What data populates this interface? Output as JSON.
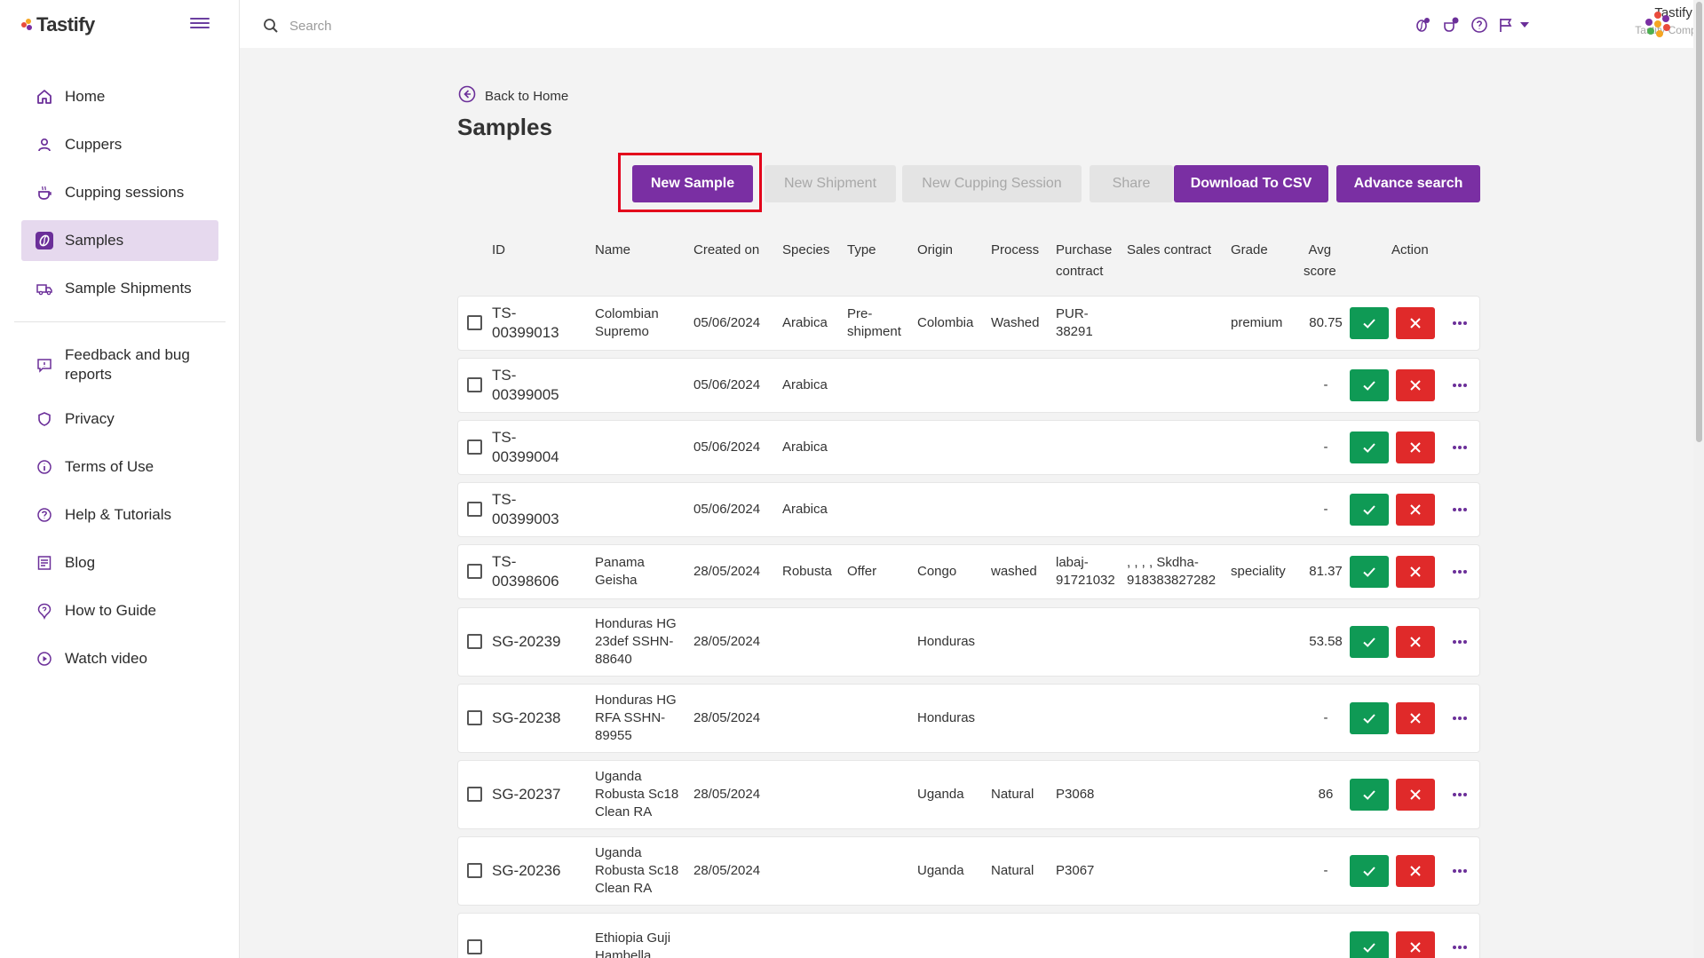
{
  "app": {
    "logo_text": "Tastify"
  },
  "search": {
    "placeholder": "Search"
  },
  "user": {
    "name": "Tastify Inc",
    "company": "Tastify Company"
  },
  "sidebar": {
    "items": [
      {
        "label": "Home",
        "icon": "home-icon"
      },
      {
        "label": "Cuppers",
        "icon": "user-icon"
      },
      {
        "label": "Cupping sessions",
        "icon": "cup-icon"
      },
      {
        "label": "Samples",
        "icon": "coffee-bean-icon",
        "active": true
      },
      {
        "label": "Sample Shipments",
        "icon": "truck-icon"
      }
    ],
    "secondary": [
      {
        "label": "Feedback and bug reports",
        "icon": "feedback-icon"
      },
      {
        "label": "Privacy",
        "icon": "shield-icon"
      },
      {
        "label": "Terms of Use",
        "icon": "info-icon"
      },
      {
        "label": "Help & Tutorials",
        "icon": "help-icon"
      },
      {
        "label": "Blog",
        "icon": "blog-icon"
      },
      {
        "label": "How to Guide",
        "icon": "guide-icon"
      },
      {
        "label": "Watch video",
        "icon": "play-icon"
      }
    ]
  },
  "page": {
    "back_label": "Back to Home",
    "title": "Samples"
  },
  "toolbar": {
    "new_sample": "New Sample",
    "new_shipment": "New Shipment",
    "new_cupping_session": "New Cupping Session",
    "share": "Share",
    "download_csv": "Download To CSV",
    "advance_search": "Advance search"
  },
  "table": {
    "headers": {
      "id": "ID",
      "name": "Name",
      "created_on": "Created on",
      "species": "Species",
      "type": "Type",
      "origin": "Origin",
      "process": "Process",
      "purchase_contract_1": "Purchase",
      "purchase_contract_2": "contract",
      "sales_contract": "Sales contract",
      "grade": "Grade",
      "avg_score_1": "Avg",
      "avg_score_2": "score",
      "action": "Action"
    },
    "rows": [
      {
        "id1": "TS-",
        "id2": "00399013",
        "name": [
          "Colombian",
          "Supremo"
        ],
        "created": "05/06/2024",
        "species": "Arabica",
        "type": [
          "Pre-",
          "shipment"
        ],
        "origin": "Colombia",
        "process": "Washed",
        "purchase": [
          "PUR-",
          "38291"
        ],
        "sales": [],
        "grade": "premium",
        "score": "80.75"
      },
      {
        "id1": "TS-",
        "id2": "00399005",
        "name": [],
        "created": "05/06/2024",
        "species": "Arabica",
        "type": [],
        "origin": "",
        "process": "",
        "purchase": [],
        "sales": [],
        "grade": "",
        "score": "-"
      },
      {
        "id1": "TS-",
        "id2": "00399004",
        "name": [],
        "created": "05/06/2024",
        "species": "Arabica",
        "type": [],
        "origin": "",
        "process": "",
        "purchase": [],
        "sales": [],
        "grade": "",
        "score": "-"
      },
      {
        "id1": "TS-",
        "id2": "00399003",
        "name": [],
        "created": "05/06/2024",
        "species": "Arabica",
        "type": [],
        "origin": "",
        "process": "",
        "purchase": [],
        "sales": [],
        "grade": "",
        "score": "-"
      },
      {
        "id1": "TS-",
        "id2": "00398606",
        "name": [
          "Panama",
          "Geisha"
        ],
        "created": "28/05/2024",
        "species": "Robusta",
        "type": [
          "Offer"
        ],
        "origin": "Congo",
        "process": "washed",
        "purchase": [
          "labaj-",
          "91721032"
        ],
        "sales": [
          ", , , , Skdha-",
          "918383827282"
        ],
        "grade": "speciality",
        "score": "81.37"
      },
      {
        "id1": "SG-20239",
        "id2": "",
        "name": [
          "Honduras HG",
          "23def SSHN-",
          "88640"
        ],
        "created": "28/05/2024",
        "species": "",
        "type": [],
        "origin": "Honduras",
        "process": "",
        "purchase": [],
        "sales": [],
        "grade": "",
        "score": "53.58"
      },
      {
        "id1": "SG-20238",
        "id2": "",
        "name": [
          "Honduras HG",
          "RFA SSHN-",
          "89955"
        ],
        "created": "28/05/2024",
        "species": "",
        "type": [],
        "origin": "Honduras",
        "process": "",
        "purchase": [],
        "sales": [],
        "grade": "",
        "score": "-"
      },
      {
        "id1": "SG-20237",
        "id2": "",
        "name": [
          "Uganda",
          "Robusta Sc18",
          "Clean RA"
        ],
        "created": "28/05/2024",
        "species": "",
        "type": [],
        "origin": "Uganda",
        "process": "Natural",
        "purchase": [
          "P3068"
        ],
        "sales": [],
        "grade": "",
        "score": "86"
      },
      {
        "id1": "SG-20236",
        "id2": "",
        "name": [
          "Uganda",
          "Robusta Sc18",
          "Clean RA"
        ],
        "created": "28/05/2024",
        "species": "",
        "type": [],
        "origin": "Uganda",
        "process": "Natural",
        "purchase": [
          "P3067"
        ],
        "sales": [],
        "grade": "",
        "score": "-"
      },
      {
        "id1": "",
        "id2": "",
        "name": [
          "Ethiopia Guji",
          "Hambella"
        ],
        "created": "",
        "species": "",
        "type": [],
        "origin": "",
        "process": "",
        "purchase": [],
        "sales": [],
        "grade": "",
        "score": ""
      }
    ]
  },
  "colors": {
    "brand": "#7a2fa3",
    "approve": "#0f9a55",
    "reject": "#e02a2a",
    "highlight": "#e3001b"
  }
}
